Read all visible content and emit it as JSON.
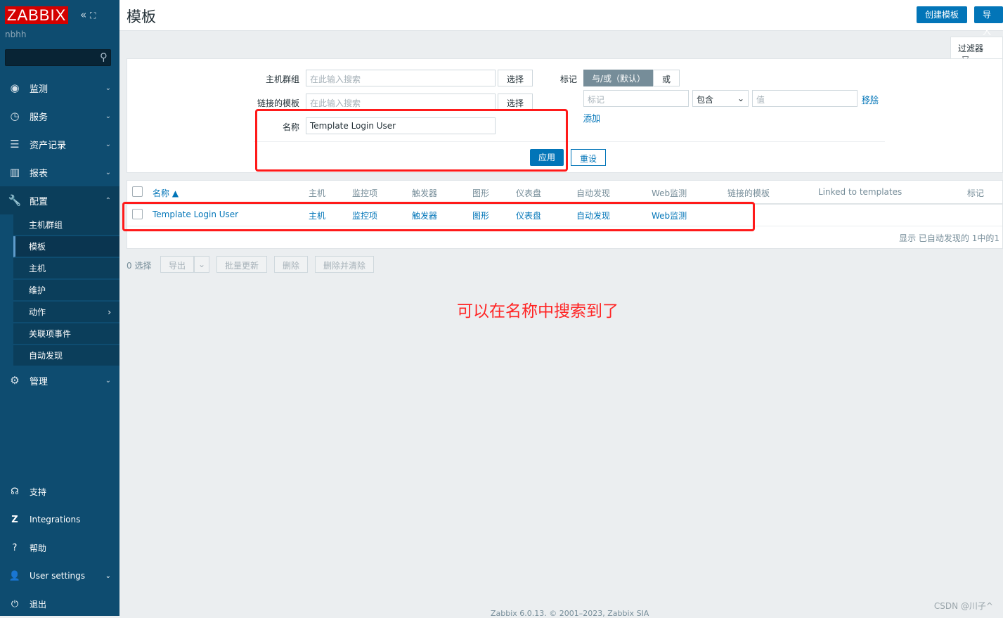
{
  "sidebar": {
    "logo": "ZABBIX",
    "user": "nbhh",
    "search_placeholder": "",
    "menu": [
      {
        "label": "监测",
        "icon": "eye-icon"
      },
      {
        "label": "服务",
        "icon": "clock-icon"
      },
      {
        "label": "资产记录",
        "icon": "list-icon"
      },
      {
        "label": "报表",
        "icon": "chart-icon"
      },
      {
        "label": "配置",
        "icon": "wrench-icon"
      },
      {
        "label": "管理",
        "icon": "gear-icon"
      }
    ],
    "submenu": [
      "主机群组",
      "模板",
      "主机",
      "维护",
      "动作",
      "关联项事件",
      "自动发现"
    ],
    "bottom": [
      {
        "label": "支持",
        "icon": "headset-icon"
      },
      {
        "label": "Integrations",
        "icon": "z-icon"
      },
      {
        "label": "帮助",
        "icon": "help-icon"
      },
      {
        "label": "User settings",
        "icon": "user-icon"
      },
      {
        "label": "退出",
        "icon": "power-icon"
      }
    ]
  },
  "header": {
    "title": "模板",
    "create_button": "创建模板",
    "import_button": "导入"
  },
  "filter": {
    "tab_label": "过滤器",
    "host_group_label": "主机群组",
    "host_group_placeholder": "在此输入搜索",
    "select_label": "选择",
    "linked_label": "链接的模板",
    "linked_placeholder": "在此输入搜索",
    "name_label": "名称",
    "name_value": "Template Login User",
    "tags_label": "标记",
    "and_or": "与/或（默认）",
    "or": "或",
    "tag_placeholder": "标记",
    "operator": "包含",
    "value_placeholder": "值",
    "remove": "移除",
    "add": "添加",
    "apply": "应用",
    "reset": "重设"
  },
  "table": {
    "headers": [
      "名称 ▲",
      "主机",
      "监控项",
      "触发器",
      "图形",
      "仪表盘",
      "自动发现",
      "Web监测",
      "链接的模板",
      "Linked to templates",
      "标记"
    ],
    "rows": [
      {
        "name": "Template Login User",
        "hosts": "主机",
        "items": "监控项",
        "triggers": "触发器",
        "graphs": "图形",
        "dashboards": "仪表盘",
        "discovery": "自动发现",
        "web": "Web监测"
      }
    ],
    "summary": "显示 已自动发现的 1中的1"
  },
  "actions": {
    "selected": "0 选择",
    "export": "导出",
    "mass_update": "批量更新",
    "delete": "删除",
    "delete_clear": "删除并清除"
  },
  "annotation": "可以在名称中搜索到了",
  "footer": "Zabbix 6.0.13. © 2001–2023, Zabbix SIA",
  "watermark": "CSDN @川子^",
  "colors": {
    "sidebar": "#0e4c70",
    "accent": "#0275b8",
    "highlight": "#ff1a1a",
    "logo": "#d40000"
  }
}
